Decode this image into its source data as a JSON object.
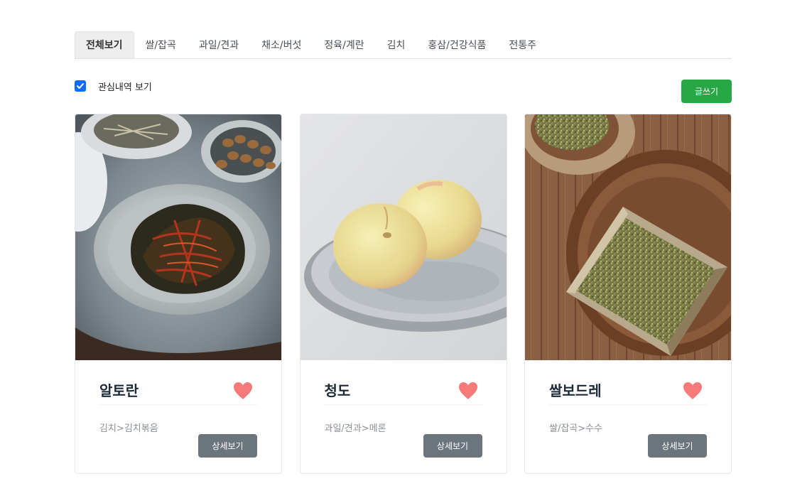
{
  "tabs": [
    {
      "label": "전체보기",
      "active": true
    },
    {
      "label": "쌀/잡곡",
      "active": false
    },
    {
      "label": "과일/견과",
      "active": false
    },
    {
      "label": "채소/버섯",
      "active": false
    },
    {
      "label": "정육/계란",
      "active": false
    },
    {
      "label": "김치",
      "active": false
    },
    {
      "label": "홍삼/건강식품",
      "active": false
    },
    {
      "label": "전통주",
      "active": false
    }
  ],
  "toolbar": {
    "interest_checkbox_label": "관심내역 보기",
    "interest_checked": true,
    "write_label": "글쓰기"
  },
  "cards": [
    {
      "title": "알토란",
      "category": "김치>김치볶음",
      "detail_label": "상세보기",
      "liked": true
    },
    {
      "title": "청도",
      "category": "과일/견과>메론",
      "detail_label": "상세보기",
      "liked": true
    },
    {
      "title": "쌀보드레",
      "category": "쌀/잡곡>수수",
      "detail_label": "상세보기",
      "liked": true
    }
  ],
  "colors": {
    "heart": "#f77a7a",
    "checkbox": "#0d6efd",
    "write_button": "#28a745",
    "detail_button": "#6c757d"
  },
  "icons": {
    "checkbox": "check-icon",
    "like": "heart-icon"
  }
}
